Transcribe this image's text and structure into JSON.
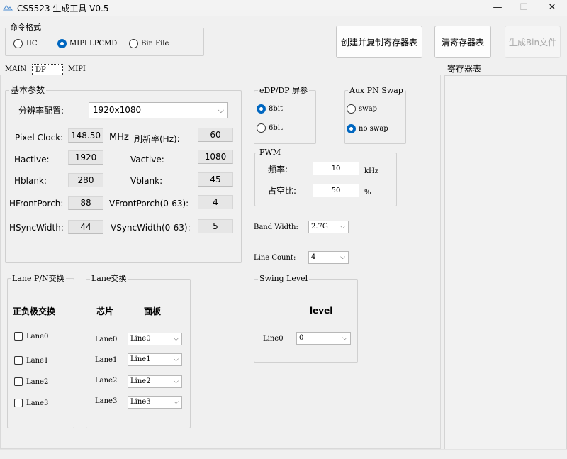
{
  "window": {
    "title": "CS5523 生成工具 V0.5",
    "min_symbol": "—",
    "max_symbol": "☐",
    "close_symbol": "✕"
  },
  "command_format": {
    "legend": "命令格式",
    "options": [
      "IIC",
      "MIPI LPCMD",
      "Bin File"
    ],
    "selected": "MIPI LPCMD"
  },
  "buttons": {
    "create_copy": "创建并复制寄存器表",
    "clear": "清寄存器表",
    "generate_bin": "生成Bin文件"
  },
  "tabs": [
    "MAIN",
    "DP",
    "MIPI"
  ],
  "active_tab": "DP",
  "register_table": {
    "title": "寄存器表"
  },
  "basic_params": {
    "legend": "基本参数",
    "resolution_label": "分辨率配置:",
    "resolution_value": "1920x1080",
    "pixel_clock_label": "Pixel Clock:",
    "pixel_clock_value": "148.50",
    "pixel_clock_unit": "MHz",
    "refresh_label": "刷新率(Hz):",
    "refresh_value": "60",
    "hactive_label": "Hactive:",
    "hactive_value": "1920",
    "vactive_label": "Vactive:",
    "vactive_value": "1080",
    "hblank_label": "Hblank:",
    "hblank_value": "280",
    "vblank_label": "Vblank:",
    "vblank_value": "45",
    "hfront_label": "HFrontPorch:",
    "hfront_value": "88",
    "vfront_label": "VFrontPorch(0-63):",
    "vfront_value": "4",
    "hsync_label": "HSyncWidth:",
    "hsync_value": "44",
    "vsync_label": "VSyncWidth(0-63):",
    "vsync_value": "5"
  },
  "edp_dp": {
    "legend": "eDP/DP 屏参",
    "options": [
      "8bit",
      "6bit"
    ],
    "selected": "8bit"
  },
  "aux_swap": {
    "legend": "Aux PN Swap",
    "options": [
      "swap",
      "no swap"
    ],
    "selected": "no swap"
  },
  "pwm": {
    "legend": "PWM",
    "freq_label": "频率:",
    "freq_value": "10",
    "freq_unit": "kHz",
    "duty_label": "占空比:",
    "duty_value": "50",
    "duty_unit": "%"
  },
  "band_width": {
    "label": "Band Width:",
    "value": "2.7G"
  },
  "line_count": {
    "label": "Line Count:",
    "value": "4"
  },
  "swing_level": {
    "legend": "Swing Level",
    "header": "level",
    "lane_label": "Line0",
    "value": "0"
  },
  "lane_pn": {
    "legend": "Lane P/N交换",
    "header": "正负极交换",
    "lanes": [
      "Lane0",
      "Lane1",
      "Lane2",
      "Lane3"
    ]
  },
  "lane_swap": {
    "legend": "Lane交换",
    "chip_header": "芯片",
    "panel_header": "面板",
    "lanes": [
      "Lane0",
      "Lane1",
      "Lane2",
      "Lane3"
    ],
    "values": [
      "Line0",
      "Line1",
      "Line2",
      "Line3"
    ]
  }
}
